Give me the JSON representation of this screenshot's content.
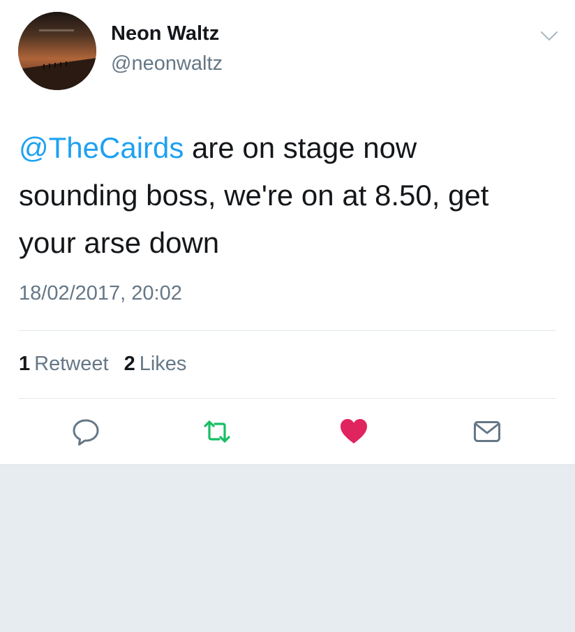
{
  "tweet": {
    "display_name": "Neon Waltz",
    "handle": "@neonwaltz",
    "text": {
      "mention": "@TheCairds",
      "line1_rest": " are on stage now",
      "line2": "sounding boss, we're on at 8.50, get",
      "line3": "your arse down"
    },
    "timestamp": "18/02/2017, 20:02",
    "stats": {
      "retweets_count": "1",
      "retweets_label": "Retweet",
      "likes_count": "2",
      "likes_label": "Likes"
    },
    "liked": true
  },
  "icons": {
    "menu": "chevron-down-icon",
    "reply": "reply-icon",
    "retweet": "retweet-icon",
    "like": "heart-icon",
    "share": "envelope-icon"
  },
  "colors": {
    "mention": "#1da1f2",
    "retweet": "#17bf63",
    "like": "#e0245e",
    "secondary_text": "#657786",
    "primary_text": "#14171a",
    "background": "#e6ecf0"
  }
}
